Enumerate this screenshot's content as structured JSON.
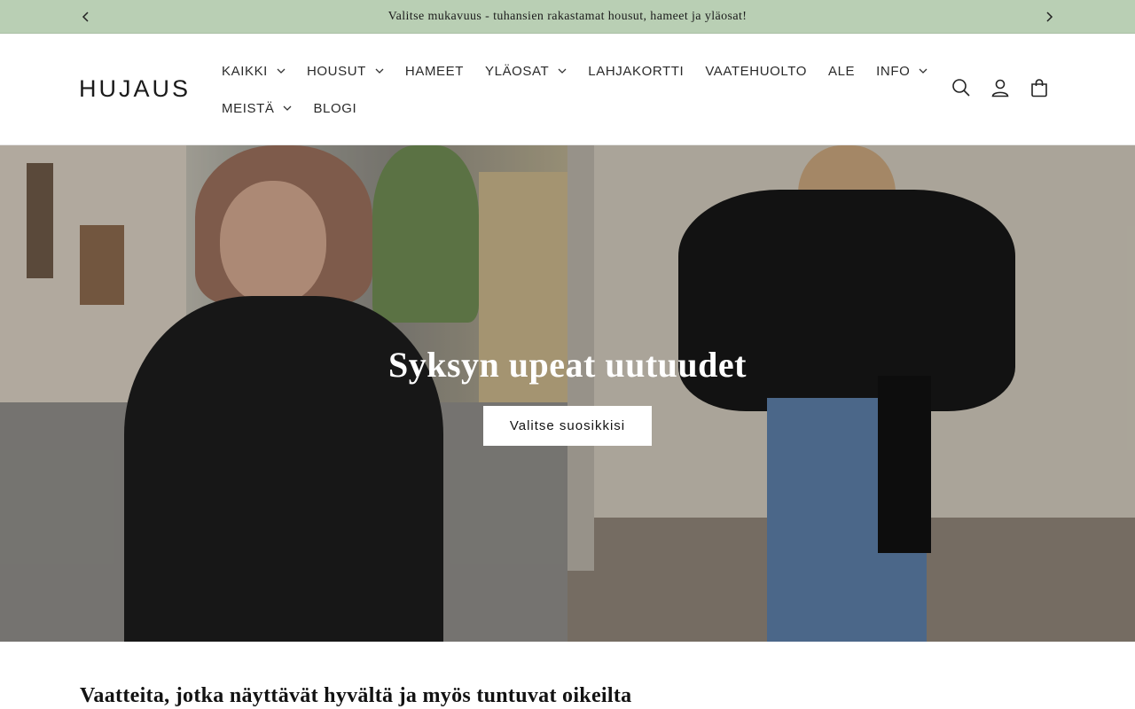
{
  "announcement": {
    "text": "Valitse mukavuus - tuhansien rakastamat housut, hameet ja yläosat!",
    "prev_icon": "chevron-left-icon",
    "next_icon": "chevron-right-icon"
  },
  "header": {
    "logo": "HUJAUS",
    "nav_row1": [
      {
        "label": "KAIKKI",
        "has_dropdown": true
      },
      {
        "label": "HOUSUT",
        "has_dropdown": true
      },
      {
        "label": "HAMEET",
        "has_dropdown": false
      },
      {
        "label": "YLÄOSAT",
        "has_dropdown": true
      },
      {
        "label": "LAHJAKORTTI",
        "has_dropdown": false
      },
      {
        "label": "VAATEHUOLTO",
        "has_dropdown": false
      },
      {
        "label": "ALE",
        "has_dropdown": false
      },
      {
        "label": "INFO",
        "has_dropdown": true
      }
    ],
    "nav_row2": [
      {
        "label": "MEISTÄ",
        "has_dropdown": true
      },
      {
        "label": "BLOGI",
        "has_dropdown": false
      }
    ],
    "icons": [
      "search-icon",
      "account-icon",
      "cart-icon"
    ]
  },
  "hero": {
    "title": "Syksyn upeat uutuudet",
    "button_label": "Valitse suosikkisi"
  },
  "intro": {
    "heading": "Vaatteita, jotka näyttävät hyvältä ja myös tuntuvat oikeilta"
  },
  "colors": {
    "announcement_bg": "#b9cfb4",
    "text": "#121212",
    "hero_button_bg": "#ffffff"
  }
}
